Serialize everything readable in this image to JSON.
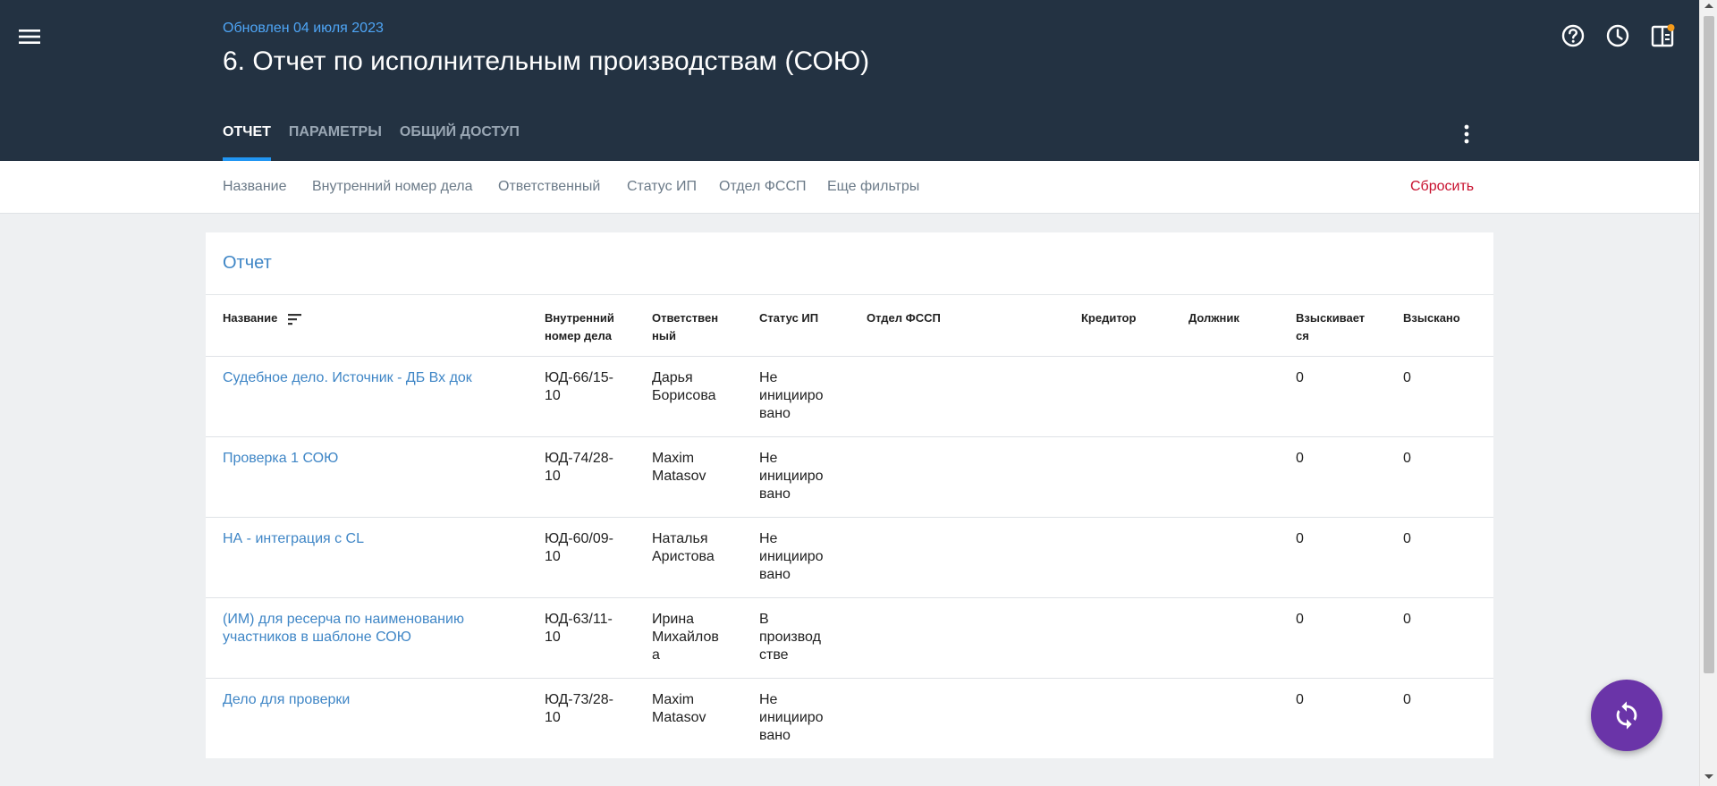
{
  "header": {
    "updated": "Обновлен 04 июля 2023",
    "title": "6. Отчет по исполнительным производствам (СОЮ)",
    "icons": [
      "menu-icon",
      "help-icon",
      "history-icon",
      "panel-icon"
    ],
    "notification_color": "#f59b1a",
    "tabs": [
      {
        "label": "Отчет",
        "active": true
      },
      {
        "label": "Параметры",
        "active": false
      },
      {
        "label": "Общий доступ",
        "active": false
      }
    ]
  },
  "filters": {
    "items": [
      "Название",
      "Внутренний номер дела",
      "Ответственный",
      "Статус ИП",
      "Отдел ФССП",
      "Еще фильтры"
    ],
    "reset_label": "Сбросить"
  },
  "report": {
    "title": "Отчет",
    "columns": [
      [
        "Название"
      ],
      [
        "Внутренний",
        "номер дела"
      ],
      [
        "Ответствен",
        "ный"
      ],
      [
        "Статус ИП"
      ],
      [
        "Отдел ФССП"
      ],
      [
        "Кредитор"
      ],
      [
        "Должник"
      ],
      [
        "Взыскивает",
        "ся"
      ],
      [
        "Взыскано"
      ]
    ],
    "rows": [
      {
        "name": [
          "Судебное дело. Источник - ДБ Вх док"
        ],
        "number": [
          "ЮД-66/15-",
          "10"
        ],
        "responsible": [
          "Дарья",
          "Борисова"
        ],
        "status": [
          "Не",
          "иницииро",
          "вано"
        ],
        "department": "",
        "creditor": "",
        "debtor": "",
        "to_collect": "0",
        "collected": "0"
      },
      {
        "name": [
          "Проверка 1 СОЮ"
        ],
        "number": [
          "ЮД-74/28-",
          "10"
        ],
        "responsible": [
          "Maxim",
          "Matasov"
        ],
        "status": [
          "Не",
          "иницииро",
          "вано"
        ],
        "department": "",
        "creditor": "",
        "debtor": "",
        "to_collect": "0",
        "collected": "0"
      },
      {
        "name": [
          "НА - интеграция с CL"
        ],
        "number": [
          "ЮД-60/09-",
          "10"
        ],
        "responsible": [
          "Наталья",
          "Аристова"
        ],
        "status": [
          "Не",
          "иницииро",
          "вано"
        ],
        "department": "",
        "creditor": "",
        "debtor": "",
        "to_collect": "0",
        "collected": "0"
      },
      {
        "name": [
          "(ИМ) для ресерча по наименованию",
          "участников в шаблоне СОЮ"
        ],
        "number": [
          "ЮД-63/11-",
          "10"
        ],
        "responsible": [
          "Ирина",
          "Михайлов",
          "а"
        ],
        "status": [
          "В",
          "производ",
          "стве"
        ],
        "department": "",
        "creditor": "",
        "debtor": "",
        "to_collect": "0",
        "collected": "0"
      },
      {
        "name": [
          "Дело для проверки"
        ],
        "number": [
          "ЮД-73/28-",
          "10"
        ],
        "responsible": [
          "Maxim",
          "Matasov"
        ],
        "status": [
          "Не",
          "иницииро",
          "вано"
        ],
        "department": "",
        "creditor": "",
        "debtor": "",
        "to_collect": "0",
        "collected": "0"
      }
    ]
  },
  "fab": {
    "icon": "sync-icon",
    "color": "#6a34a8"
  }
}
